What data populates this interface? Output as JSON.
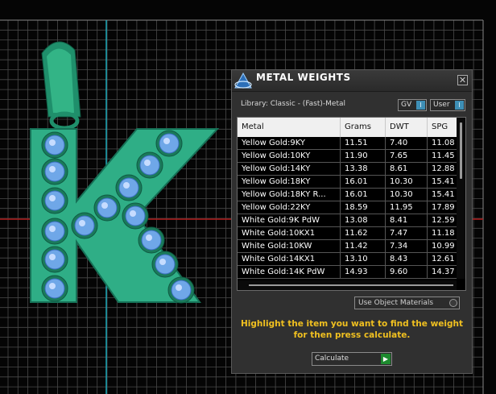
{
  "dialog": {
    "title": "METAL WEIGHTS",
    "close_icon": "close-icon",
    "library_label": "Library: Classic - (Fast)-Metal",
    "gv_toggle": {
      "label": "GV",
      "knob": "I"
    },
    "user_toggle": {
      "label": "User",
      "knob": "I"
    },
    "table": {
      "columns": [
        "Metal",
        "Grams",
        "DWT",
        "SPG"
      ],
      "rows": [
        [
          "Yellow Gold:9KY",
          "11.51",
          "7.40",
          "11.08"
        ],
        [
          "Yellow Gold:10KY",
          "11.90",
          "7.65",
          "11.45"
        ],
        [
          "Yellow Gold:14KY",
          "13.38",
          "8.61",
          "12.88"
        ],
        [
          "Yellow Gold:18KY",
          "16.01",
          "10.30",
          "15.41"
        ],
        [
          "Yellow Gold:18KY R...",
          "16.01",
          "10.30",
          "15.41"
        ],
        [
          "Yellow Gold:22KY",
          "18.59",
          "11.95",
          "17.89"
        ],
        [
          "White Gold:9K PdW",
          "13.08",
          "8.41",
          "12.59"
        ],
        [
          "White Gold:10KX1",
          "11.62",
          "7.47",
          "11.18"
        ],
        [
          "White Gold:10KW",
          "11.42",
          "7.34",
          "10.99"
        ],
        [
          "White Gold:14KX1",
          "13.10",
          "8.43",
          "12.61"
        ],
        [
          "White Gold:14K PdW",
          "14.93",
          "9.60",
          "14.37"
        ]
      ]
    },
    "use_materials_label": "Use Object Materials",
    "instructions_line1": "Highlight the item you want to find the weight",
    "instructions_line2": "for then press calculate.",
    "calculate_label": "Calculate",
    "calculate_icon": "play-arrow-icon"
  },
  "viewport": {
    "model": "letter-k-pendant",
    "model_color": "#2fae86",
    "gem_color": "#6fa7e8",
    "grid_color": "#4a4a4a"
  }
}
